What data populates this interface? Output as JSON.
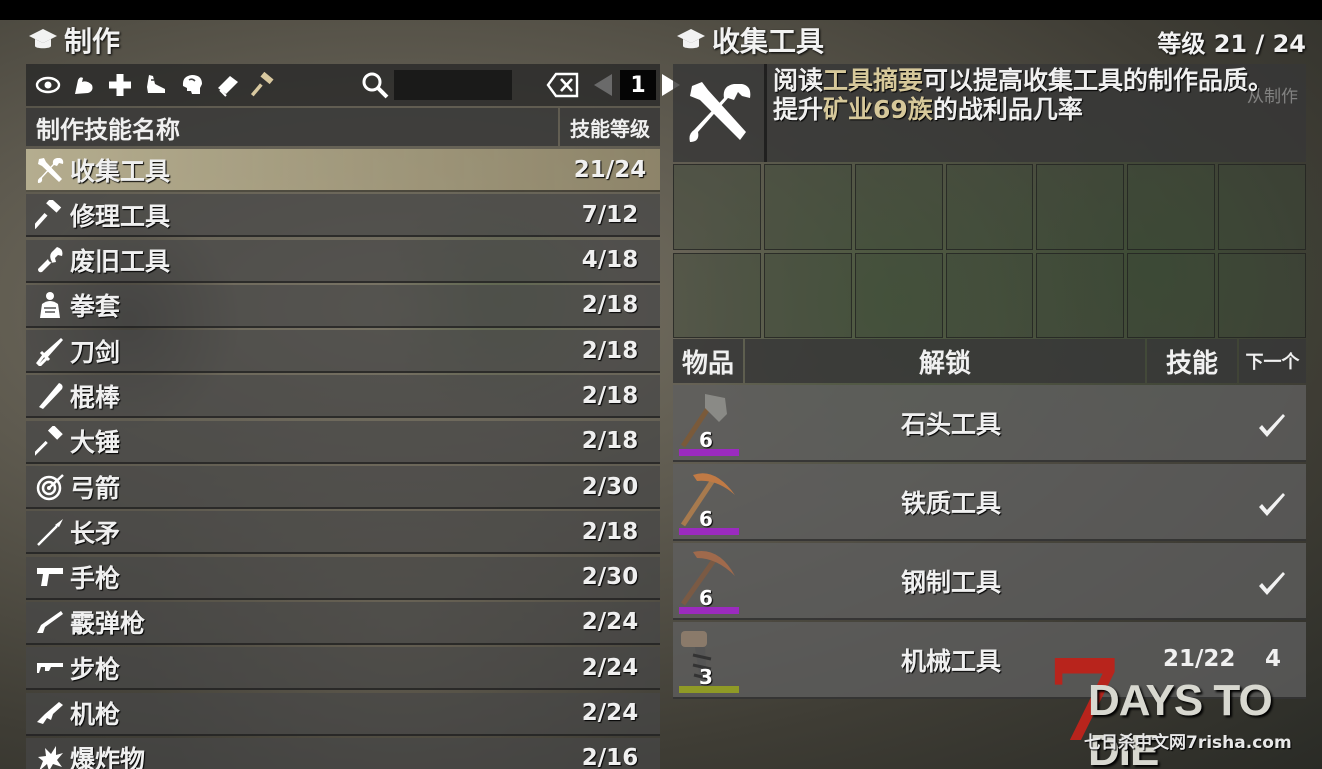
{
  "left_panel": {
    "title": "制作",
    "search": {
      "value": ""
    },
    "page": "1",
    "header": {
      "name": "制作技能名称",
      "level": "技能等级"
    },
    "category_icons": [
      "eye-icon",
      "arm-strength-icon",
      "health-cross-icon",
      "running-shoe-icon",
      "brain-icon",
      "book-icon",
      "hammer-icon"
    ],
    "skills": [
      {
        "name": "收集工具",
        "level": "21/24",
        "icon": "tools-icon",
        "selected": true
      },
      {
        "name": "修理工具",
        "level": "7/12",
        "icon": "hammer-icon"
      },
      {
        "name": "废旧工具",
        "level": "4/18",
        "icon": "wrench-icon"
      },
      {
        "name": "拳套",
        "level": "2/18",
        "icon": "brawler-icon"
      },
      {
        "name": "刀剑",
        "level": "2/18",
        "icon": "blade-icon"
      },
      {
        "name": "棍棒",
        "level": "2/18",
        "icon": "club-icon"
      },
      {
        "name": "大锤",
        "level": "2/18",
        "icon": "sledgehammer-icon"
      },
      {
        "name": "弓箭",
        "level": "2/30",
        "icon": "target-icon"
      },
      {
        "name": "长矛",
        "level": "2/18",
        "icon": "spear-icon"
      },
      {
        "name": "手枪",
        "level": "2/30",
        "icon": "pistol-icon"
      },
      {
        "name": "霰弹枪",
        "level": "2/24",
        "icon": "shotgun-icon"
      },
      {
        "name": "步枪",
        "level": "2/24",
        "icon": "rifle-icon"
      },
      {
        "name": "机枪",
        "level": "2/24",
        "icon": "machine-gun-icon"
      },
      {
        "name": "爆炸物",
        "level": "2/16",
        "icon": "explosion-icon"
      }
    ]
  },
  "right_panel": {
    "title": "收集工具",
    "level_text": "等级 21 / 24",
    "description": {
      "line1_prefix": "阅读",
      "line1_highlight": "工具摘要",
      "line1_suffix": "可以提高收集工具的制作品质。",
      "line2_prefix": "提升",
      "line2_highlight": "矿业69族",
      "line2_suffix": "的战利品几率",
      "faded_text": "从制作",
      "accent_color": "#d6c89a"
    },
    "unlock_header": {
      "item": "物品",
      "unlock": "解锁",
      "skill": "技能",
      "next": "下一个"
    },
    "unlocks": [
      {
        "name": "石头工具",
        "qty": "6",
        "bar_color": "#9b2bbf",
        "unlocked": true,
        "tool": "stone-axe-icon"
      },
      {
        "name": "铁质工具",
        "qty": "6",
        "bar_color": "#9b2bbf",
        "unlocked": true,
        "tool": "iron-pickaxe-icon"
      },
      {
        "name": "钢制工具",
        "qty": "6",
        "bar_color": "#9b2bbf",
        "unlocked": true,
        "tool": "steel-pickaxe-icon"
      },
      {
        "name": "机械工具",
        "qty": "3",
        "bar_color": "#8f9a26",
        "unlocked": false,
        "skill": "21/22",
        "next": "4",
        "tool": "auger-icon"
      }
    ]
  },
  "logo": {
    "text": "DAYS TO DIE",
    "number": "7",
    "site": "七日杀中文网7risha.com"
  }
}
